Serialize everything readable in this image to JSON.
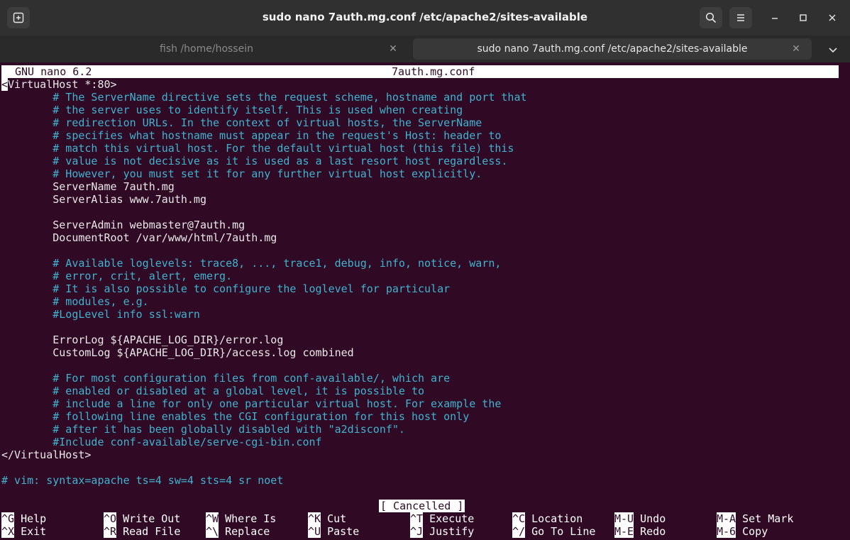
{
  "window": {
    "title": "sudo nano 7auth.mg.conf /etc/apache2/sites-available"
  },
  "tabs": [
    {
      "label": "fish /home/hossein",
      "active": false
    },
    {
      "label": "sudo nano 7auth.mg.conf /etc/apache2/sites-available",
      "active": true
    }
  ],
  "icons": {
    "new_tab": "new-tab-icon",
    "search": "search-icon",
    "menu": "hamburger-menu-icon",
    "minimize": "minimize-icon",
    "maximize": "maximize-icon",
    "close": "close-icon",
    "tab_close": "tab-close-icon",
    "tab_dropdown": "chevron-down-icon"
  },
  "editor": {
    "app_version": "GNU nano 6.2",
    "filename": "7auth.mg.conf",
    "lines": [
      {
        "text": "<VirtualHost *:80>",
        "kind": "tag"
      },
      {
        "text": "        # The ServerName directive sets the request scheme, hostname and port that",
        "kind": "comment"
      },
      {
        "text": "        # the server uses to identify itself. This is used when creating",
        "kind": "comment"
      },
      {
        "text": "        # redirection URLs. In the context of virtual hosts, the ServerName",
        "kind": "comment"
      },
      {
        "text": "        # specifies what hostname must appear in the request's Host: header to",
        "kind": "comment"
      },
      {
        "text": "        # match this virtual host. For the default virtual host (this file) this",
        "kind": "comment"
      },
      {
        "text": "        # value is not decisive as it is used as a last resort host regardless.",
        "kind": "comment"
      },
      {
        "text": "        # However, you must set it for any further virtual host explicitly.",
        "kind": "comment"
      },
      {
        "text": "        ServerName 7auth.mg",
        "kind": "text"
      },
      {
        "text": "        ServerAlias www.7auth.mg",
        "kind": "text"
      },
      {
        "text": "",
        "kind": "text"
      },
      {
        "text": "        ServerAdmin webmaster@7auth.mg",
        "kind": "text"
      },
      {
        "text": "        DocumentRoot /var/www/html/7auth.mg",
        "kind": "text"
      },
      {
        "text": "",
        "kind": "text"
      },
      {
        "text": "        # Available loglevels: trace8, ..., trace1, debug, info, notice, warn,",
        "kind": "comment"
      },
      {
        "text": "        # error, crit, alert, emerg.",
        "kind": "comment"
      },
      {
        "text": "        # It is also possible to configure the loglevel for particular",
        "kind": "comment"
      },
      {
        "text": "        # modules, e.g.",
        "kind": "comment"
      },
      {
        "text": "        #LogLevel info ssl:warn",
        "kind": "comment"
      },
      {
        "text": "",
        "kind": "text"
      },
      {
        "text": "        ErrorLog ${APACHE_LOG_DIR}/error.log",
        "kind": "text"
      },
      {
        "text": "        CustomLog ${APACHE_LOG_DIR}/access.log combined",
        "kind": "text"
      },
      {
        "text": "",
        "kind": "text"
      },
      {
        "text": "        # For most configuration files from conf-available/, which are",
        "kind": "comment"
      },
      {
        "text": "        # enabled or disabled at a global level, it is possible to",
        "kind": "comment"
      },
      {
        "text": "        # include a line for only one particular virtual host. For example the",
        "kind": "comment"
      },
      {
        "text": "        # following line enables the CGI configuration for this host only",
        "kind": "comment"
      },
      {
        "text": "        # after it has been globally disabled with \"a2disconf\".",
        "kind": "comment"
      },
      {
        "text": "        #Include conf-available/serve-cgi-bin.conf",
        "kind": "comment"
      },
      {
        "text": "</VirtualHost>",
        "kind": "tag"
      },
      {
        "text": "",
        "kind": "text"
      },
      {
        "text": "# vim: syntax=apache ts=4 sw=4 sts=4 sr noet",
        "kind": "comment"
      }
    ],
    "status_message": "[ Cancelled ]",
    "shortcuts_row1": [
      {
        "key": "^G",
        "label": "Help"
      },
      {
        "key": "^O",
        "label": "Write Out"
      },
      {
        "key": "^W",
        "label": "Where Is"
      },
      {
        "key": "^K",
        "label": "Cut"
      },
      {
        "key": "^T",
        "label": "Execute"
      },
      {
        "key": "^C",
        "label": "Location"
      },
      {
        "key": "M-U",
        "label": "Undo"
      },
      {
        "key": "M-A",
        "label": "Set Mark"
      }
    ],
    "shortcuts_row2": [
      {
        "key": "^X",
        "label": "Exit"
      },
      {
        "key": "^R",
        "label": "Read File"
      },
      {
        "key": "^\\",
        "label": "Replace"
      },
      {
        "key": "^U",
        "label": "Paste"
      },
      {
        "key": "^J",
        "label": "Justify"
      },
      {
        "key": "^/",
        "label": "Go To Line"
      },
      {
        "key": "M-E",
        "label": "Redo"
      },
      {
        "key": "M-6",
        "label": "Copy"
      }
    ]
  },
  "colors": {
    "terminal_bg": "#300a24",
    "comment": "#3fb3cf",
    "titlebar": "#303030"
  }
}
